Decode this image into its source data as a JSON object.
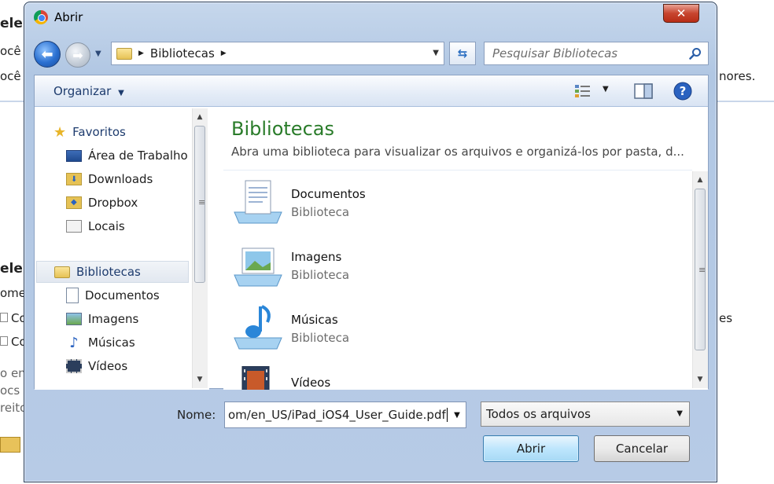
{
  "background": {
    "texts": [
      {
        "id": "t1",
        "text": "ele"
      },
      {
        "id": "t2",
        "text": "ocê"
      },
      {
        "id": "t3",
        "text": "ocê"
      },
      {
        "id": "t4",
        "text": "nores."
      },
      {
        "id": "t5",
        "text": "ele"
      },
      {
        "id": "t6",
        "text": "ome"
      },
      {
        "id": "t7",
        "text": "Co"
      },
      {
        "id": "t8",
        "text": "Co"
      },
      {
        "id": "t9",
        "text": "es"
      },
      {
        "id": "t10",
        "text": "o en"
      },
      {
        "id": "t11",
        "text": "ocs"
      },
      {
        "id": "t12",
        "text": "reito"
      }
    ]
  },
  "dialog": {
    "title": "Abrir",
    "close_label": "✕",
    "address": {
      "crumb": "Bibliotecas"
    },
    "search": {
      "placeholder": "Pesquisar Bibliotecas"
    },
    "toolbar": {
      "organize_label": "Organizar"
    },
    "nav": {
      "favorites_header": "Favoritos",
      "favorites": [
        {
          "label": "Área de Trabalho"
        },
        {
          "label": "Downloads"
        },
        {
          "label": "Dropbox"
        },
        {
          "label": "Locais"
        }
      ],
      "libraries_header": "Bibliotecas",
      "libraries": [
        {
          "label": "Documentos"
        },
        {
          "label": "Imagens"
        },
        {
          "label": "Músicas"
        },
        {
          "label": "Vídeos"
        }
      ]
    },
    "content": {
      "title": "Bibliotecas",
      "subtitle": "Abra uma biblioteca para visualizar os arquivos e organizá-los por pasta, d...",
      "items": [
        {
          "name": "Documentos",
          "type": "Biblioteca"
        },
        {
          "name": "Imagens",
          "type": "Biblioteca"
        },
        {
          "name": "Músicas",
          "type": "Biblioteca"
        },
        {
          "name": "Vídeos",
          "type": ""
        }
      ]
    },
    "filename": {
      "label": "Nome:",
      "value": "om/en_US/iPad_iOS4_User_Guide.pdf"
    },
    "filetype": {
      "value": "Todos os arquivos"
    },
    "buttons": {
      "open": "Abrir",
      "cancel": "Cancelar"
    }
  }
}
